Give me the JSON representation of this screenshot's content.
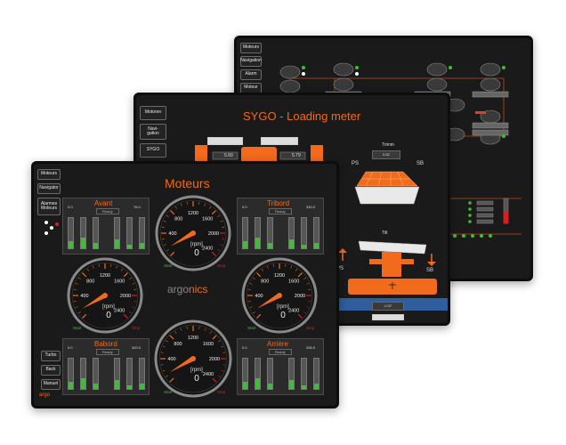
{
  "colors": {
    "accent": "#f26a1b",
    "screen_bg": "#1a1a1a",
    "panel_bg": "#2b2b2b",
    "led_green": "#39c12f",
    "led_white": "#ffffff",
    "led_red": "#d42020"
  },
  "back_screen": {
    "nav": [
      "Moteurs",
      "Navigation",
      "Alarm",
      "Moteur"
    ],
    "status_led": "red"
  },
  "middle_screen": {
    "title": "SYGO - Loading meter",
    "nav": [
      "Motoren",
      "Navi-\ngation",
      "SYGO"
    ],
    "values": {
      "left_top": "5.60",
      "right_top": "5.79",
      "trim_label": "Trimm",
      "trim_value": "0.52",
      "tilt_label": "Tilt",
      "tilt_value": "-0.37"
    },
    "side_labels": {
      "ps": "PS",
      "sb": "SB"
    },
    "icons": [
      "ship-trim-icon",
      "ship-tilt-icon",
      "arrow-up-icon",
      "arrow-down-icon"
    ]
  },
  "front_screen": {
    "title": "Moteurs",
    "nav": [
      "Moteurs",
      "Navigator",
      "Alarmes Moteurs"
    ],
    "bottom_nav": [
      "Turbo",
      "Back",
      "Manuel"
    ],
    "footer_logo": "argo",
    "center_logo": {
      "a": "argo",
      "b": "nics"
    },
    "engines": [
      {
        "name": "Avant",
        "mode": "Ready",
        "left_val": "0.0",
        "right_val": "76.0",
        "rpm": "0",
        "unit": "[rpm]",
        "start": "Start",
        "stop": "Stop"
      },
      {
        "name": "Tribord",
        "mode": "Ready",
        "left_val": "0.0",
        "right_val": "330.0",
        "rpm": "0",
        "unit": "[rpm]",
        "start": "Start",
        "stop": "Stop"
      },
      {
        "name": "Babord",
        "mode": "Ready",
        "left_val": "0.0",
        "right_val": "320.0",
        "rpm": "0",
        "unit": "[rpm]",
        "start": "Start",
        "stop": "Stop"
      },
      {
        "name": "Arrière",
        "mode": "Ready",
        "left_val": "0.0",
        "right_val": "335.0",
        "rpm": "0",
        "unit": "[rpm]",
        "start": "Start",
        "stop": "Stop"
      }
    ],
    "gauge_ticks": [
      "400",
      "800",
      "1200",
      "1600",
      "2000",
      "2400"
    ],
    "gauge_ticks_left": [
      "800",
      "1200",
      "1600",
      "400",
      "2000",
      "2400"
    ]
  }
}
